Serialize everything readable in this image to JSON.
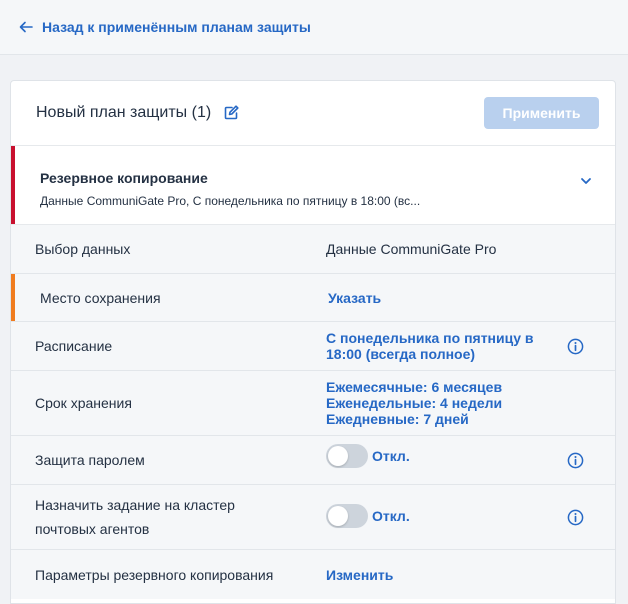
{
  "header": {
    "back_label": "Назад к применённым планам защиты"
  },
  "plan": {
    "title": "Новый план защиты (1)",
    "apply_label": "Применить"
  },
  "module": {
    "title": "Резервное копирование",
    "summary": "Данные CommuniGate Pro, С понедельника по пятницу в 18:00 (вс..."
  },
  "rows": {
    "data": {
      "label": "Выбор данных",
      "value": "Данные CommuniGate Pro"
    },
    "location": {
      "label": "Место сохранения",
      "value": "Указать"
    },
    "schedule": {
      "label": "Расписание",
      "value_line1": "С понедельника по пятницу в",
      "value_line2": "18:00 (всегда полное)"
    },
    "retention": {
      "label": "Срок хранения",
      "monthly": "Ежемесячные: 6 месяцев",
      "weekly": "Еженедельные: 4 недели",
      "daily": "Ежедневные: 7 дней"
    },
    "password": {
      "label": "Защита паролем",
      "toggle_label": "Откл."
    },
    "cluster": {
      "label_line1": "Назначить задание на кластер",
      "label_line2": "почтовых агентов",
      "toggle_label": "Откл."
    },
    "backup_options": {
      "label": "Параметры резервного копирования",
      "value": "Изменить"
    }
  },
  "colors": {
    "accent": "#2668c5",
    "module_bar": "#c8102e",
    "warning_bar": "#f07c1f",
    "apply_disabled": "#b9d0ee"
  }
}
